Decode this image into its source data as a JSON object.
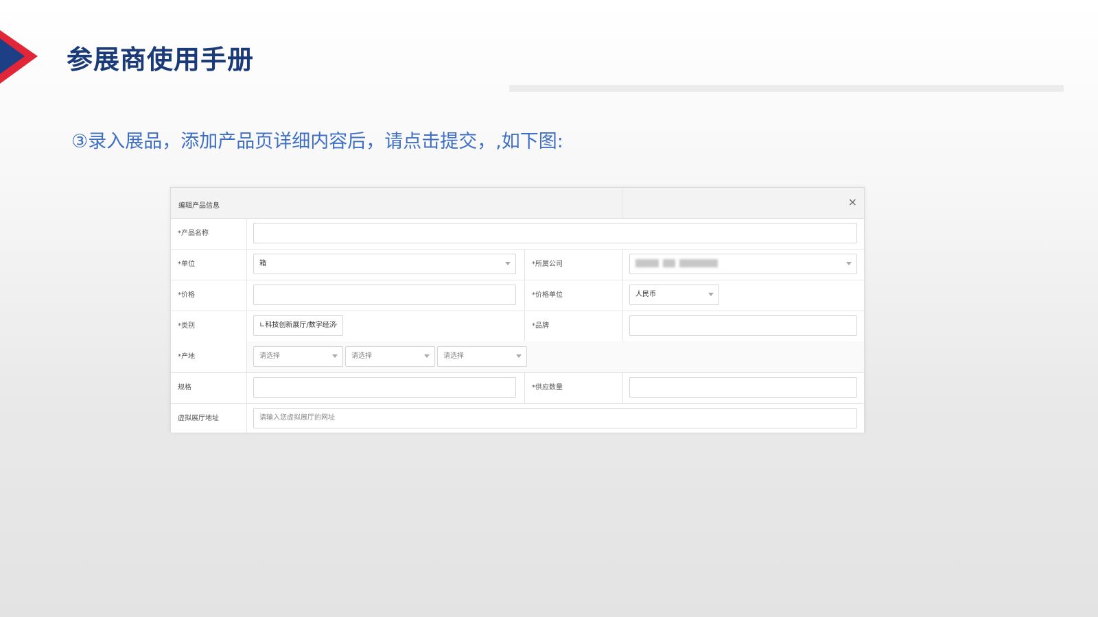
{
  "header": {
    "title": "参展商使用手册",
    "instruction": "③录入展品，添加产品页详细内容后，请点击提交，,如下图:"
  },
  "dialog": {
    "title": "编辑产品信息",
    "close": "×",
    "fields": {
      "product_name": {
        "label": "*产品名称",
        "value": ""
      },
      "unit": {
        "label": "*单位",
        "value": "箱"
      },
      "company": {
        "label": "*所属公司",
        "value": ""
      },
      "price": {
        "label": "*价格",
        "value": ""
      },
      "price_unit": {
        "label": "*价格单位",
        "value": "人民币"
      },
      "category": {
        "label": "*类别",
        "value": "∟科技创新展厅/数字经济"
      },
      "brand": {
        "label": "*品牌",
        "value": ""
      },
      "origin": {
        "label": "*产地",
        "selects": [
          "请选择",
          "请选择",
          "请选择"
        ]
      },
      "spec": {
        "label": "规格",
        "value": ""
      },
      "supply_qty": {
        "label": "*供应数量",
        "value": ""
      },
      "virtual_hall": {
        "label": "虚拟展厅地址",
        "placeholder": "请输入您虚拟展厅的网址"
      }
    }
  },
  "colors": {
    "title": "#1b3a78",
    "instruction": "#3f6fc4",
    "accent_red": "#e02637",
    "accent_blue": "#1d3f86"
  }
}
